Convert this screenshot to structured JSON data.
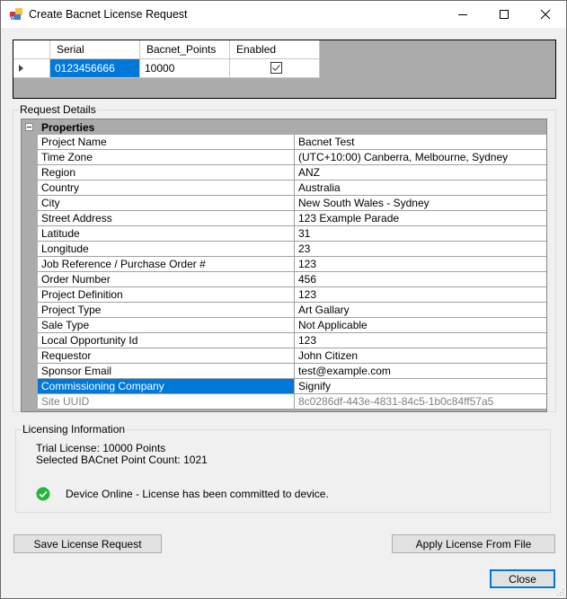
{
  "window": {
    "title": "Create Bacnet License Request",
    "icon": "app-icon",
    "controls": {
      "minimize": "minimize-icon",
      "maximize": "maximize-icon",
      "close": "close-icon"
    }
  },
  "grid": {
    "columns": [
      "",
      "Serial",
      "Bacnet_Points",
      "Enabled"
    ],
    "rows": [
      {
        "serial": "0123456666",
        "bacnet_points": "10000",
        "enabled": true
      }
    ]
  },
  "request_details": {
    "legend": "Request Details",
    "category": "Properties",
    "properties": [
      {
        "name": "Project Name",
        "value": "Bacnet Test"
      },
      {
        "name": "Time Zone",
        "value": "(UTC+10:00) Canberra, Melbourne, Sydney"
      },
      {
        "name": "Region",
        "value": "ANZ"
      },
      {
        "name": "Country",
        "value": "Australia"
      },
      {
        "name": "City",
        "value": "New South Wales - Sydney"
      },
      {
        "name": "Street Address",
        "value": "123 Example Parade"
      },
      {
        "name": "Latitude",
        "value": "31"
      },
      {
        "name": "Longitude",
        "value": "23"
      },
      {
        "name": "Job Reference / Purchase Order #",
        "value": "123"
      },
      {
        "name": "Order Number",
        "value": "456"
      },
      {
        "name": "Project Definition",
        "value": "123"
      },
      {
        "name": "Project Type",
        "value": "Art Gallary"
      },
      {
        "name": "Sale Type",
        "value": "Not Applicable"
      },
      {
        "name": "Local Opportunity Id",
        "value": "123"
      },
      {
        "name": "Requestor",
        "value": "John Citizen"
      },
      {
        "name": "Sponsor Email",
        "value": "test@example.com"
      },
      {
        "name": "Commissioning Company",
        "value": "Signify"
      },
      {
        "name": "Site UUID",
        "value": "8c0286df-443e-4831-84c5-1b0c84ff57a5"
      }
    ],
    "selected_property": "Commissioning Company",
    "readonly_property": "Site UUID"
  },
  "licensing": {
    "legend": "Licensing Information",
    "trial_license": "Trial License: 10000 Points",
    "point_count": "Selected BACnet Point Count: 1021",
    "status_icon": "check-circle-icon",
    "status_text": "Device Online - License has been committed to device.",
    "status_color": "#1fb839"
  },
  "buttons": {
    "save": "Save License Request",
    "apply": "Apply License From File",
    "close": "Close"
  },
  "colors": {
    "selection": "#0078d7",
    "grid_background": "#ababab"
  }
}
